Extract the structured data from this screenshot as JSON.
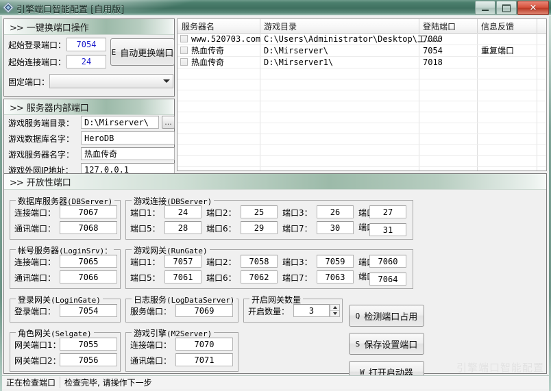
{
  "window": {
    "title": "引擎端口智能配置 [自用版]",
    "icon": "diamond-app-icon",
    "minimize_label": "最小化",
    "maximize_label": "最大化",
    "close_label": "✕"
  },
  "quick_panel": {
    "header": "一键换端口操作",
    "chevron": ">>",
    "start_login_port_label": "起始登录端口：",
    "start_login_port_value": "7054",
    "start_conn_port_label": "起始连接端口：",
    "start_conn_port_value": "24",
    "fixed_port_label": "固定端口：",
    "fixed_port_value": "",
    "auto_change_button": "自动更换端口",
    "auto_change_accel": "E"
  },
  "internal_panel": {
    "header": "服务器内部端口",
    "chevron": ">>",
    "fields": [
      {
        "label": "游戏服务端目录：",
        "value": "D:\\Mirserver\\",
        "mono": true
      },
      {
        "label": "游戏数据库名字：",
        "value": "HeroDB",
        "mono": true
      },
      {
        "label": "游戏服务器名字：",
        "value": "热血传奇",
        "mono": false
      },
      {
        "label": "游戏外网IP地址：",
        "value": "127.0.0.1",
        "mono": true
      }
    ],
    "browse_button": "..."
  },
  "grid": {
    "columns": [
      "服务器名",
      "游戏目录",
      "登陆端口",
      "信息反馈"
    ],
    "rows": [
      {
        "checked": false,
        "name": "www.520703.com",
        "name_mono": true,
        "dir": "C:\\Users\\Administrator\\Desktop\\工...",
        "port": "7000",
        "feedback": ""
      },
      {
        "checked": false,
        "name": "热血传奇",
        "name_mono": false,
        "dir": "D:\\Mirserver\\",
        "port": "7054",
        "feedback": "重复端口"
      },
      {
        "checked": false,
        "name": "热血传奇",
        "name_mono": false,
        "dir": "D:\\Mirserver1\\",
        "port": "7018",
        "feedback": ""
      }
    ]
  },
  "open_ports": {
    "header": "开放性端口",
    "chevron": ">>",
    "groups": {
      "dbserver": {
        "caption_cn": "数据库服务器",
        "caption_en": "(DBServer)",
        "fields": [
          {
            "label": "连接端口：",
            "value": "7067"
          },
          {
            "label": "通讯端口：",
            "value": "7068"
          }
        ]
      },
      "loginsrv": {
        "caption_cn": "帐号服务器",
        "caption_en": "(LoginSrv)：",
        "fields": [
          {
            "label": "连接端口：",
            "value": "7065"
          },
          {
            "label": "通讯端口：",
            "value": "7066"
          }
        ]
      },
      "logingate": {
        "caption_cn": "登录网关",
        "caption_en": "(LoginGate)",
        "fields": [
          {
            "label": "登录端口：",
            "value": "7054"
          }
        ]
      },
      "selgate": {
        "caption_cn": "角色网关",
        "caption_en": "(Selgate)",
        "fields": [
          {
            "label": "网关端口1：",
            "value": "7055"
          },
          {
            "label": "网关端口2：",
            "value": "7056"
          }
        ]
      },
      "game_conn": {
        "caption_cn": "游戏连接",
        "caption_en": "(DBServer)",
        "ports": [
          {
            "label": "端口1：",
            "value": "24"
          },
          {
            "label": "端口2：",
            "value": "25"
          },
          {
            "label": "端口3：",
            "value": "26"
          },
          {
            "label": "端口4：",
            "value": "27"
          },
          {
            "label": "端口5：",
            "value": "28"
          },
          {
            "label": "端口6：",
            "value": "29"
          },
          {
            "label": "端口7：",
            "value": "30"
          },
          {
            "label": "端口8：",
            "value": "31"
          }
        ]
      },
      "rungate": {
        "caption_cn": "游戏网关",
        "caption_en": "(RunGate)",
        "ports": [
          {
            "label": "端口1：",
            "value": "7057"
          },
          {
            "label": "端口2：",
            "value": "7058"
          },
          {
            "label": "端口3：",
            "value": "7059"
          },
          {
            "label": "端口4：",
            "value": "7060"
          },
          {
            "label": "端口5：",
            "value": "7061"
          },
          {
            "label": "端口6：",
            "value": "7062"
          },
          {
            "label": "端口7：",
            "value": "7063"
          },
          {
            "label": "端口8：",
            "value": "7064"
          }
        ]
      },
      "logdata": {
        "caption_cn": "日志服务",
        "caption_en": "(LogDataServer)",
        "fields": [
          {
            "label": "服务端口：",
            "value": "7069"
          }
        ]
      },
      "m2server": {
        "caption_cn": "游戏引擎",
        "caption_en": "(M2Server)",
        "fields": [
          {
            "label": "连接端口：",
            "value": "7070"
          },
          {
            "label": "通讯端口：",
            "value": "7071"
          }
        ]
      },
      "gate_count": {
        "caption_cn": "开启网关数量",
        "caption_en": "",
        "fields": [
          {
            "label": "开启数量：",
            "value": "3"
          }
        ]
      }
    },
    "buttons": [
      {
        "accel": "Q",
        "label": "检测端口占用"
      },
      {
        "accel": "S",
        "label": "保存设置端口"
      },
      {
        "accel": "W",
        "label": "打开启动器"
      }
    ]
  },
  "statusbar": {
    "left": "正在检查端口",
    "right": "检查完毕, 请操作下一步"
  },
  "watermark": "引擎端口智能配置"
}
